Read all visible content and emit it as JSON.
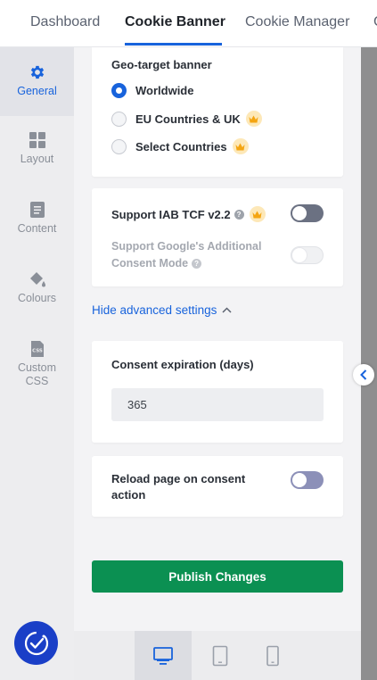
{
  "top_tabs": [
    {
      "label": "Dashboard"
    },
    {
      "label": "Cookie Banner"
    },
    {
      "label": "Cookie Manager"
    },
    {
      "label": "C"
    }
  ],
  "sidebar": {
    "items": [
      {
        "label": "General",
        "icon": "gear-icon",
        "active": true
      },
      {
        "label": "Layout",
        "icon": "layout-grid-icon"
      },
      {
        "label": "Content",
        "icon": "document-icon"
      },
      {
        "label": "Colours",
        "icon": "paint-bucket-icon"
      },
      {
        "label_line1": "Custom",
        "label_line2": "CSS",
        "icon": "css-file-icon"
      }
    ]
  },
  "geo": {
    "title": "Geo-target banner",
    "options": [
      {
        "label": "Worldwide",
        "selected": true
      },
      {
        "label": "EU Countries & UK",
        "premium": true
      },
      {
        "label": "Select Countries",
        "premium": true
      }
    ]
  },
  "iab": {
    "tcf_label": "Support IAB TCF v2.2",
    "tcf_enabled": false,
    "google_label_line1": "Support Google's Additional",
    "google_label_line2": "Consent Mode",
    "google_enabled": false
  },
  "advanced": {
    "toggle_label": "Hide advanced settings"
  },
  "consent_expiration": {
    "label": "Consent expiration (days)",
    "value": "365"
  },
  "reload": {
    "label_line1": "Reload page on consent",
    "label_line2": "action",
    "enabled": false
  },
  "publish_label": "Publish Changes",
  "devices": [
    {
      "name": "desktop",
      "active": true
    },
    {
      "name": "tablet"
    },
    {
      "name": "mobile"
    }
  ],
  "colors": {
    "accent": "#1863dc",
    "publish": "#0b9052",
    "premium_badge": "#fde8b8",
    "fab": "#1a3fc7"
  }
}
